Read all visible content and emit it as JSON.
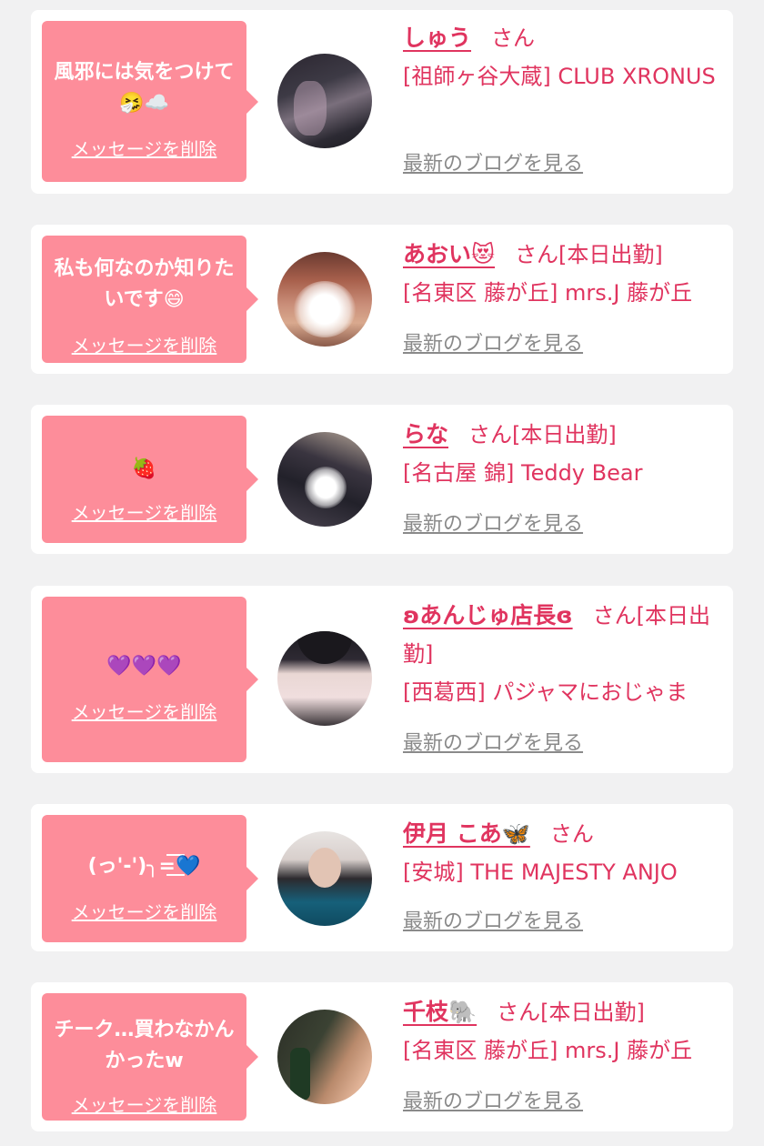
{
  "common": {
    "delete_label": "メッセージを削除",
    "blog_label": "最新のブログを見る"
  },
  "cards": [
    {
      "message": "風邪には気をつけて🤧☁️",
      "name": "しゅう",
      "suffix": "さん",
      "shop": "[祖師ヶ谷大蔵] CLUB XRONUS"
    },
    {
      "message": "私も何なのか知りたいです😄",
      "name": "あおい😻",
      "suffix": "さん[本日出勤]",
      "shop": "[名東区 藤が丘] mrs.J 藤が丘"
    },
    {
      "message": "🍓",
      "name": "らな",
      "suffix": "さん[本日出勤]",
      "shop": "[名古屋 錦] Teddy Bear"
    },
    {
      "message": "💜💜💜",
      "name": "ʚあんじゅ店長ɞ",
      "suffix": "さん[本日出勤]",
      "shop": "[西葛西] パジャマにおじゃま"
    },
    {
      "message": "(っ'-')╮=͟͟͞͞💙",
      "name": "伊月 こあ🦋",
      "suffix": "さん",
      "shop": "[安城] THE MAJESTY ANJO"
    },
    {
      "message": "チーク…買わなかんかったw",
      "name": "千枝🐘",
      "suffix": "さん[本日出勤]",
      "shop": "[名東区 藤が丘] mrs.J 藤が丘"
    }
  ]
}
